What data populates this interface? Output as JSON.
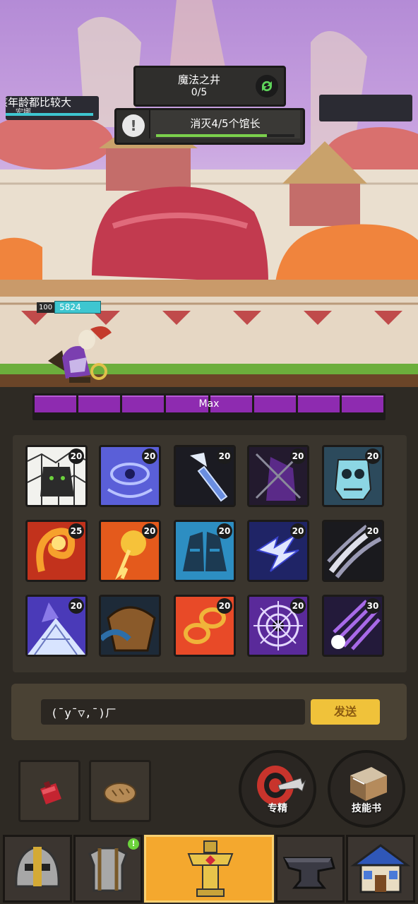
{
  "quest": {
    "title": "魔法之井",
    "progress": "0/5",
    "task": "消灭4/5个馆长",
    "task_progress": 0.8
  },
  "left_banner": {
    "text": "孩年龄都比较大",
    "subtext": "宏娜"
  },
  "hero": {
    "level": "100",
    "hp": "5824"
  },
  "xp_bar": {
    "label": "Max",
    "segments": 8
  },
  "skills": [
    {
      "icon": "cracked-shield-icon",
      "level": "20"
    },
    {
      "icon": "eye-vortex-icon",
      "level": "20"
    },
    {
      "icon": "ice-spear-icon",
      "level": "20"
    },
    {
      "icon": "shadow-blade-icon",
      "level": "20"
    },
    {
      "icon": "skull-mask-icon",
      "level": "20"
    },
    {
      "icon": "fire-swirl-icon",
      "level": "25"
    },
    {
      "icon": "fireball-icon",
      "level": "20"
    },
    {
      "icon": "twin-hoods-icon",
      "level": "20"
    },
    {
      "icon": "lightning-icon",
      "level": "20"
    },
    {
      "icon": "claw-slash-icon",
      "level": "20"
    },
    {
      "icon": "crystal-shard-icon",
      "level": "20"
    },
    {
      "icon": "leather-bag-icon",
      "level": ""
    },
    {
      "icon": "chain-link-icon",
      "level": "20"
    },
    {
      "icon": "void-web-icon",
      "level": "20"
    },
    {
      "icon": "purple-comet-icon",
      "level": "30"
    }
  ],
  "chat": {
    "input_value": "(ˉyˉ▽,ˉ)ㄏ",
    "send_label": "发送"
  },
  "items": [
    {
      "icon": "red-potion-icon"
    },
    {
      "icon": "bread-icon"
    }
  ],
  "round_buttons": {
    "mastery_label": "专精",
    "skillbook_label": "技能书"
  },
  "bottom_nav": [
    {
      "icon": "helmet-icon"
    },
    {
      "icon": "armor-icon",
      "badge": "!"
    },
    {
      "icon": "altar-icon",
      "active": true
    },
    {
      "icon": "anvil-icon"
    },
    {
      "icon": "shop-house-icon"
    }
  ],
  "colors": {
    "accent_yellow": "#f0c23a",
    "xp_purple": "#8e2bb0",
    "hp_cyan": "#3ec6d0",
    "active_tab": "#f4a82e"
  }
}
